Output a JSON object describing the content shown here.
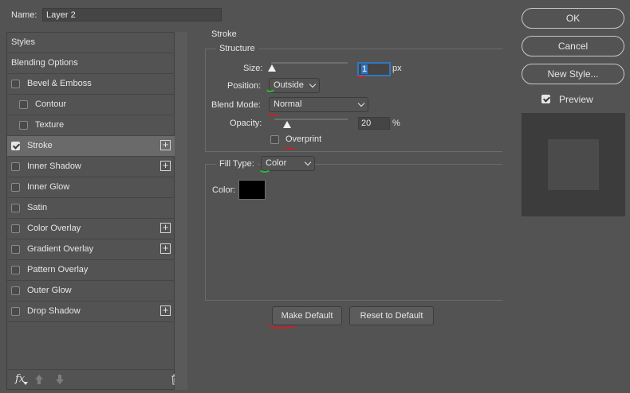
{
  "name_row": {
    "label": "Name:",
    "value": "Layer 2"
  },
  "styles": [
    {
      "label": "Styles",
      "checkbox": false,
      "checked": false,
      "plus": false,
      "indent": false,
      "selected": false
    },
    {
      "label": "Blending Options",
      "checkbox": false,
      "checked": false,
      "plus": false,
      "indent": false,
      "selected": false
    },
    {
      "label": "Bevel & Emboss",
      "checkbox": true,
      "checked": false,
      "plus": false,
      "indent": false,
      "selected": false
    },
    {
      "label": "Contour",
      "checkbox": true,
      "checked": false,
      "plus": false,
      "indent": true,
      "selected": false
    },
    {
      "label": "Texture",
      "checkbox": true,
      "checked": false,
      "plus": false,
      "indent": true,
      "selected": false
    },
    {
      "label": "Stroke",
      "checkbox": true,
      "checked": true,
      "plus": true,
      "indent": false,
      "selected": true
    },
    {
      "label": "Inner Shadow",
      "checkbox": true,
      "checked": false,
      "plus": true,
      "indent": false,
      "selected": false
    },
    {
      "label": "Inner Glow",
      "checkbox": true,
      "checked": false,
      "plus": false,
      "indent": false,
      "selected": false
    },
    {
      "label": "Satin",
      "checkbox": true,
      "checked": false,
      "plus": false,
      "indent": false,
      "selected": false
    },
    {
      "label": "Color Overlay",
      "checkbox": true,
      "checked": false,
      "plus": true,
      "indent": false,
      "selected": false
    },
    {
      "label": "Gradient Overlay",
      "checkbox": true,
      "checked": false,
      "plus": true,
      "indent": false,
      "selected": false
    },
    {
      "label": "Pattern Overlay",
      "checkbox": true,
      "checked": false,
      "plus": false,
      "indent": false,
      "selected": false
    },
    {
      "label": "Outer Glow",
      "checkbox": true,
      "checked": false,
      "plus": false,
      "indent": false,
      "selected": false
    },
    {
      "label": "Drop Shadow",
      "checkbox": true,
      "checked": false,
      "plus": true,
      "indent": false,
      "selected": false
    }
  ],
  "bottom_bar": {
    "fx_label": "fx",
    "up_icon": "arrow-up-icon",
    "down_icon": "arrow-down-icon",
    "trash_icon": "trash-icon"
  },
  "stroke": {
    "section_title": "Stroke",
    "structure_title": "Structure",
    "size": {
      "label": "Size:",
      "value": "1",
      "unit": "px",
      "slider_fraction": 0.0
    },
    "position": {
      "label": "Position:",
      "value": "Outside"
    },
    "blend_mode": {
      "label": "Blend Mode:",
      "value": "Normal"
    },
    "opacity": {
      "label": "Opacity:",
      "value": "20",
      "unit": "%",
      "slider_fraction": 0.2
    },
    "overprint": {
      "label": "Overprint",
      "checked": false
    },
    "fill_type": {
      "label": "Fill Type:",
      "value": "Color"
    },
    "color": {
      "label": "Color:",
      "swatch": "#000000"
    },
    "make_default": "Make Default",
    "reset_default": "Reset to Default"
  },
  "right": {
    "ok": "OK",
    "cancel": "Cancel",
    "new_style": "New Style...",
    "preview": {
      "label": "Preview",
      "checked": true
    }
  },
  "colors": {
    "annotation_red": "#d11f1f",
    "annotation_green": "#2fb53a",
    "focus_blue": "#2f78c4"
  }
}
